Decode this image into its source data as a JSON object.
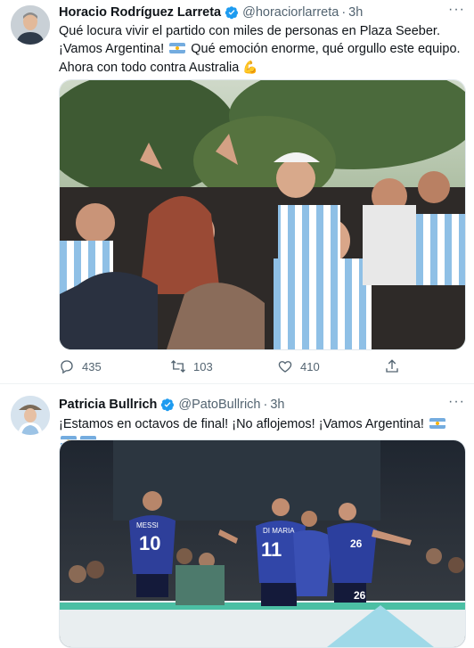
{
  "tweets": [
    {
      "author_name": "Horacio Rodríguez Larreta",
      "handle": "@horaciorlarreta",
      "separator": "·",
      "time": "3h",
      "text_part1": "Qué locura vivir el partido con miles de personas en Plaza Seeber. ¡Vamos Argentina! ",
      "text_part2": " Qué emoción enorme, qué orgullo este equipo. Ahora con todo contra Australia ",
      "muscle_emoji": "💪",
      "replies": "435",
      "retweets": "103",
      "likes": "410"
    },
    {
      "author_name": "Patricia Bullrich",
      "handle": "@PatoBullrich",
      "separator": "·",
      "time": "3h",
      "text": "¡Estamos en octavos de final! ¡No aflojemos! ¡Vamos Argentina! "
    }
  ],
  "more_label": "···",
  "colors": {
    "verified": "#1d9bf0",
    "argentina_blue": "#74acdf",
    "secondary_text": "#536471"
  },
  "icons": [
    "verified-badge-icon",
    "reply-icon",
    "retweet-icon",
    "like-icon",
    "share-icon",
    "argentina-flag-icon"
  ],
  "jersey_numbers": [
    "10",
    "11",
    "26",
    "26"
  ],
  "jersey_names": [
    "MESSI",
    "DI MARIA"
  ]
}
